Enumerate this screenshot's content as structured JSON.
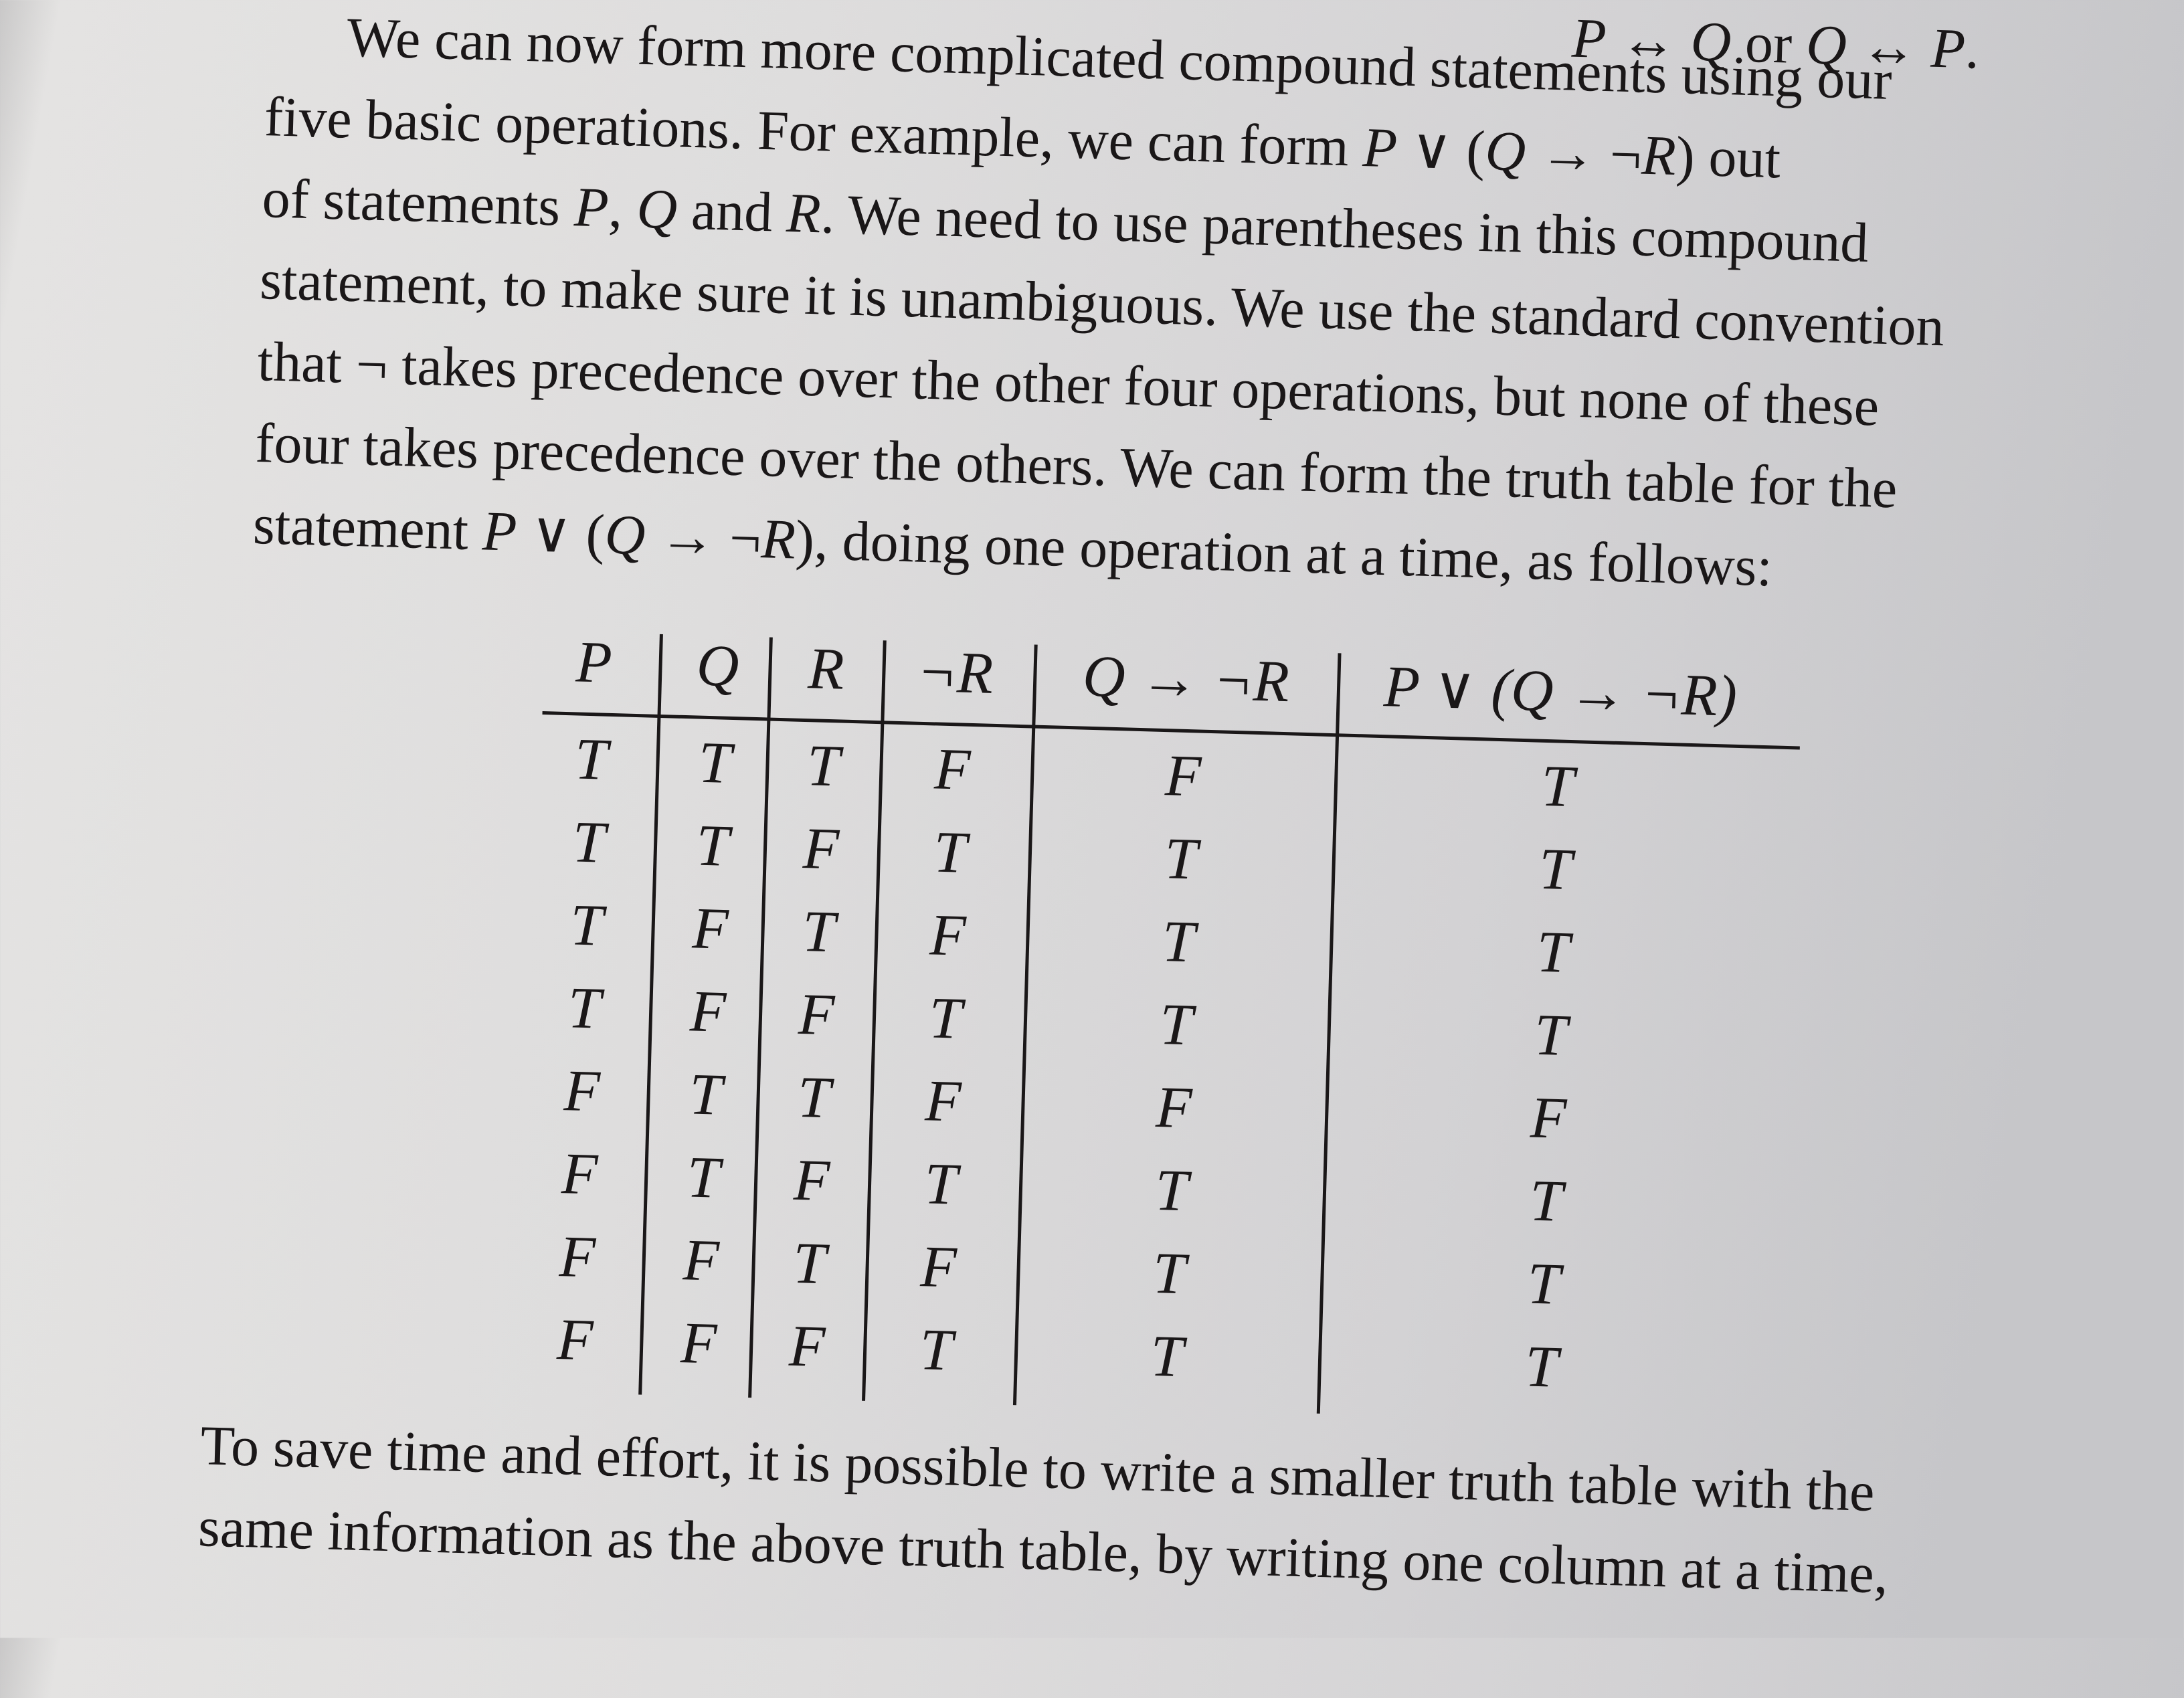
{
  "paragraph_top": [
    [
      [
        "We can now form more complicated compound statements using our",
        false
      ]
    ],
    [
      [
        "five basic operations. For example, we can form ",
        false
      ],
      [
        "P",
        true
      ],
      [
        " ∨ (",
        false
      ],
      [
        "Q",
        true
      ],
      [
        " → ¬",
        false
      ],
      [
        "R",
        true
      ],
      [
        ") out",
        false
      ]
    ],
    [
      [
        "of statements ",
        false
      ],
      [
        "P",
        true
      ],
      [
        ", ",
        false
      ],
      [
        "Q",
        true
      ],
      [
        " and ",
        false
      ],
      [
        "R",
        true
      ],
      [
        ". We need to use parentheses in this compound",
        false
      ]
    ],
    [
      [
        "statement, to make sure it is unambiguous. We use the standard convention",
        false
      ]
    ],
    [
      [
        "that ¬ takes precedence over the other four operations, but none of these",
        false
      ]
    ],
    [
      [
        "four takes precedence over the others. We can form the truth table for the",
        false
      ]
    ],
    [
      [
        "statement ",
        false
      ],
      [
        "P",
        true
      ],
      [
        " ∨ (",
        false
      ],
      [
        "Q",
        true
      ],
      [
        " → ¬",
        false
      ],
      [
        "R",
        true
      ],
      [
        "), doing one operation at a time, as follows:",
        false
      ]
    ]
  ],
  "top_fragment": [
    [
      "P",
      true
    ],
    [
      " ↔ ",
      false
    ],
    [
      "Q",
      true
    ],
    [
      " or ",
      false
    ],
    [
      "Q",
      true
    ],
    [
      " ↔ ",
      false
    ],
    [
      "P",
      true
    ],
    [
      ".",
      false
    ]
  ],
  "truth_table": {
    "headers": [
      "P",
      "Q",
      "R",
      "¬R",
      "Q → ¬R",
      "P ∨ (Q → ¬R)"
    ],
    "rows": [
      [
        "T",
        "T",
        "T",
        "F",
        "F",
        "T"
      ],
      [
        "T",
        "T",
        "F",
        "T",
        "T",
        "T"
      ],
      [
        "T",
        "F",
        "T",
        "F",
        "T",
        "T"
      ],
      [
        "T",
        "F",
        "F",
        "T",
        "T",
        "T"
      ],
      [
        "F",
        "T",
        "T",
        "F",
        "F",
        "F"
      ],
      [
        "F",
        "T",
        "F",
        "T",
        "T",
        "T"
      ],
      [
        "F",
        "F",
        "T",
        "F",
        "T",
        "T"
      ],
      [
        "F",
        "F",
        "F",
        "T",
        "T",
        "T"
      ]
    ]
  },
  "paragraph_bottom": [
    [
      [
        "To save time and effort, it is possible to write a smaller truth table with the",
        false
      ]
    ],
    [
      [
        "same information as the above truth table, by writing one column at a time,",
        false
      ]
    ]
  ]
}
